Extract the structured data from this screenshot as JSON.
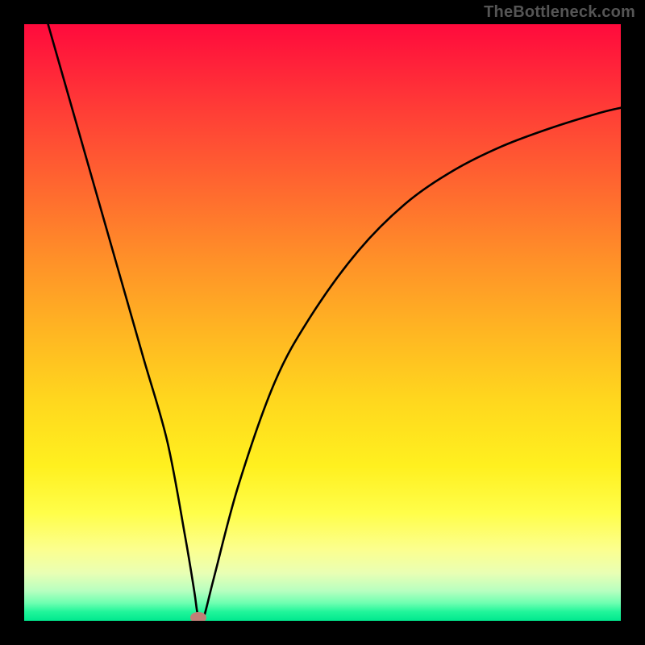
{
  "attribution": "TheBottleneck.com",
  "chart_data": {
    "type": "line",
    "title": "",
    "xlabel": "",
    "ylabel": "",
    "xlim": [
      0,
      100
    ],
    "ylim": [
      0,
      100
    ],
    "grid": false,
    "background": "rainbow-gradient-red-to-green",
    "series": [
      {
        "name": "curve",
        "color": "#000000",
        "x": [
          4,
          8,
          12,
          16,
          20,
          24,
          27,
          28.5,
          29,
          29.5,
          30,
          30.5,
          32,
          36,
          42,
          48,
          56,
          64,
          72,
          80,
          88,
          96,
          100
        ],
        "y": [
          100,
          86,
          72,
          58,
          44,
          30,
          14,
          5,
          1.5,
          0.4,
          0.4,
          2,
          8,
          23,
          40,
          51,
          62,
          70,
          75.5,
          79.5,
          82.5,
          85,
          86
        ]
      }
    ],
    "annotations": [
      {
        "type": "dot",
        "x": 29.2,
        "y": 0.5,
        "color": "#c17f77",
        "shape": "ellipse"
      }
    ]
  }
}
